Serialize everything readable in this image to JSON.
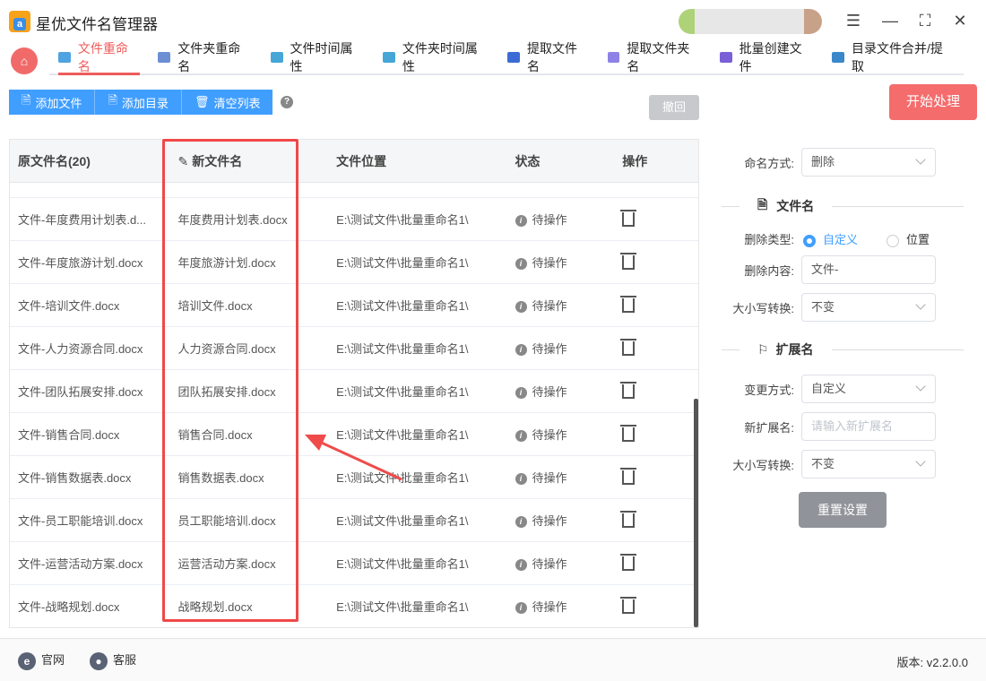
{
  "app": {
    "title": "星优文件名管理器",
    "logo_text": "a"
  },
  "nav": {
    "tabs": [
      {
        "label": "文件重命名",
        "color": "#4fa3e0"
      },
      {
        "label": "文件夹重命名",
        "color": "#6c8fd4"
      },
      {
        "label": "文件时间属性",
        "color": "#46a7d6"
      },
      {
        "label": "文件夹时间属性",
        "color": "#46a7d6"
      },
      {
        "label": "提取文件名",
        "color": "#3d6bd6"
      },
      {
        "label": "提取文件夹名",
        "color": "#8f82e6"
      },
      {
        "label": "批量创建文件",
        "color": "#7a5fd6"
      },
      {
        "label": "目录文件合并/提取",
        "color": "#3a88c9"
      }
    ]
  },
  "toolbar": {
    "add_file": "添加文件",
    "add_dir": "添加目录",
    "clear_list": "清空列表",
    "help": "?",
    "undo": "撤回",
    "start": "开始处理"
  },
  "table": {
    "headers": [
      "原文件名(20)",
      "新文件名",
      "文件位置",
      "状态",
      "操作"
    ],
    "rows": [
      {
        "orig": "文件-年度费用计划表.d...",
        "new": "年度费用计划表.docx",
        "path": "E:\\测试文件\\批量重命名1\\",
        "status": "待操作"
      },
      {
        "orig": "文件-年度旅游计划.docx",
        "new": "年度旅游计划.docx",
        "path": "E:\\测试文件\\批量重命名1\\",
        "status": "待操作"
      },
      {
        "orig": "文件-培训文件.docx",
        "new": "培训文件.docx",
        "path": "E:\\测试文件\\批量重命名1\\",
        "status": "待操作"
      },
      {
        "orig": "文件-人力资源合同.docx",
        "new": "人力资源合同.docx",
        "path": "E:\\测试文件\\批量重命名1\\",
        "status": "待操作"
      },
      {
        "orig": "文件-团队拓展安排.docx",
        "new": "团队拓展安排.docx",
        "path": "E:\\测试文件\\批量重命名1\\",
        "status": "待操作"
      },
      {
        "orig": "文件-销售合同.docx",
        "new": "销售合同.docx",
        "path": "E:\\测试文件\\批量重命名1\\",
        "status": "待操作"
      },
      {
        "orig": "文件-销售数据表.docx",
        "new": "销售数据表.docx",
        "path": "E:\\测试文件\\批量重命名1\\",
        "status": "待操作"
      },
      {
        "orig": "文件-员工职能培训.docx",
        "new": "员工职能培训.docx",
        "path": "E:\\测试文件\\批量重命名1\\",
        "status": "待操作"
      },
      {
        "orig": "文件-运营活动方案.docx",
        "new": "运营活动方案.docx",
        "path": "E:\\测试文件\\批量重命名1\\",
        "status": "待操作"
      },
      {
        "orig": "文件-战略规划.docx",
        "new": "战略规划.docx",
        "path": "E:\\测试文件\\批量重命名1\\",
        "status": "待操作"
      }
    ]
  },
  "panel": {
    "naming_label": "命名方式:",
    "naming_value": "删除",
    "filename_section": "文件名",
    "delete_type_label": "删除类型:",
    "delete_type_options": [
      "自定义",
      "位置"
    ],
    "delete_content_label": "删除内容:",
    "delete_content_value": "文件-",
    "case_label": "大小写转换:",
    "case_value": "不变",
    "ext_section": "扩展名",
    "change_mode_label": "变更方式:",
    "change_mode_value": "自定义",
    "new_ext_label": "新扩展名:",
    "new_ext_placeholder": "请输入新扩展名",
    "ext_case_label": "大小写转换:",
    "ext_case_value": "不变",
    "reset": "重置设置"
  },
  "footer": {
    "website": "官网",
    "support": "客服",
    "version": "版本: v2.2.0.0"
  }
}
